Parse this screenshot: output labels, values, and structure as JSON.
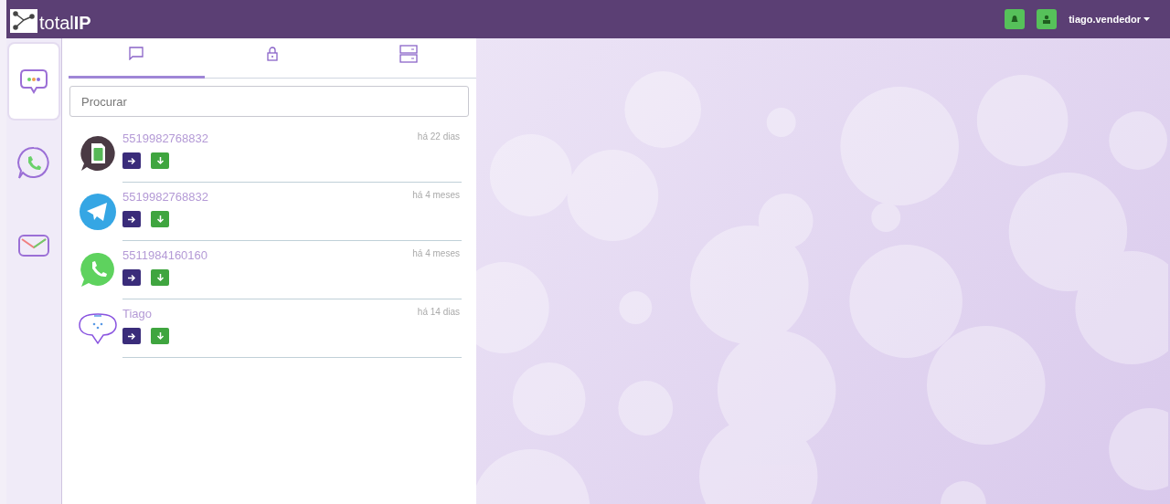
{
  "header": {
    "logo": "total**IP**",
    "user": "tiago.vendedor"
  },
  "rail": [
    {
      "kind": "chat",
      "selected": true
    },
    {
      "kind": "phone",
      "selected": false
    },
    {
      "kind": "mail",
      "selected": false
    }
  ],
  "tabs": [
    {
      "kind": "chat",
      "selected": true
    },
    {
      "kind": "lock",
      "selected": false
    },
    {
      "kind": "server",
      "selected": false
    }
  ],
  "search": {
    "placeholder": "Procurar"
  },
  "conversations": [
    {
      "kind": "sms",
      "name": "5519982768832",
      "time": "há 22 dias"
    },
    {
      "kind": "telegram",
      "name": "5519982768832",
      "time": "há 4 meses"
    },
    {
      "kind": "whatsapp",
      "name": "5511984160160",
      "time": "há 4 meses"
    },
    {
      "kind": "webchat",
      "name": "Tiago",
      "time": "há 14 dias"
    }
  ]
}
